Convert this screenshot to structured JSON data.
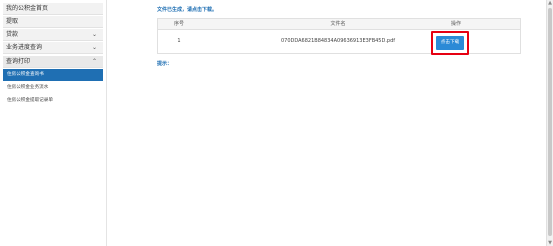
{
  "sidebar": {
    "items": [
      {
        "label": "我的公积金首页"
      },
      {
        "label": "提取"
      },
      {
        "label": "贷款"
      },
      {
        "label": "业务进度查询"
      },
      {
        "label": "查询打印"
      }
    ],
    "subitems": [
      {
        "label": "住房公积金查询书"
      },
      {
        "label": "住房公积金业务流水"
      },
      {
        "label": "住房公积金提取记录单"
      }
    ]
  },
  "main": {
    "hint_top": "文件已生成，请点击下载。",
    "table": {
      "headers": [
        "序号",
        "文件名",
        "操作"
      ],
      "rows": [
        {
          "index": "1",
          "filename": "070DDA6821B84834A09636913E3FB45D.pdf",
          "action": "点击下载"
        }
      ]
    },
    "hint_bottom": "提示："
  },
  "icons": {
    "chevron_down": "chevron-down-icon",
    "chevron_up": "chevron-up-icon"
  },
  "colors": {
    "accent": "#1f6fb3",
    "button": "#2b8ad6",
    "highlight_border": "#e60012"
  }
}
